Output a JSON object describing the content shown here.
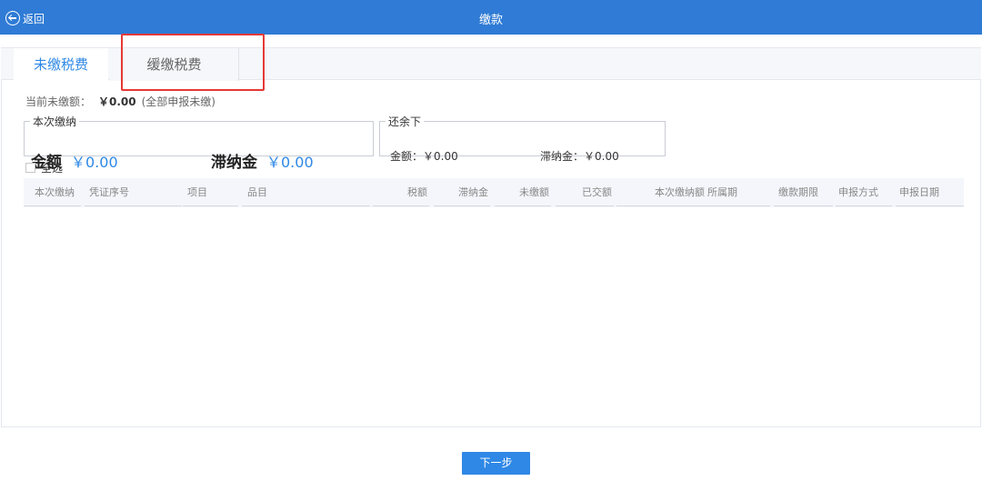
{
  "header": {
    "back_label": "返回",
    "title": "缴款",
    "bg_color": "#2f7bd5"
  },
  "tabs": [
    {
      "label": "未缴税费",
      "active": true
    },
    {
      "label": "缓缴税费",
      "active": false
    }
  ],
  "current_unpaid": {
    "label": "当前未缴额：",
    "amount": "￥0.00",
    "note": "(全部申报未缴)"
  },
  "this_payment": {
    "legend": "本次缴纳",
    "amount_label": "金额",
    "amount_value": "￥0.00",
    "late_fee_label": "滞纳金",
    "late_fee_value": "￥0.00"
  },
  "remaining": {
    "legend": "还余下",
    "amount_text": "金额：￥0.00",
    "late_fee_text": "滞纳金：￥0.00"
  },
  "select_all": {
    "label": "全选",
    "checked": false
  },
  "table": {
    "columns": [
      "本次缴纳",
      "凭证序号",
      "项目",
      "品目",
      "税额",
      "滞纳金",
      "未缴额",
      "已交额",
      "本次缴纳额",
      "所属期",
      "缴款期限",
      "申报方式",
      "申报日期"
    ],
    "rows": []
  },
  "next_button": {
    "label": "下一步"
  },
  "colors": {
    "accent": "#2f88e6",
    "highlight": "#e53935"
  }
}
